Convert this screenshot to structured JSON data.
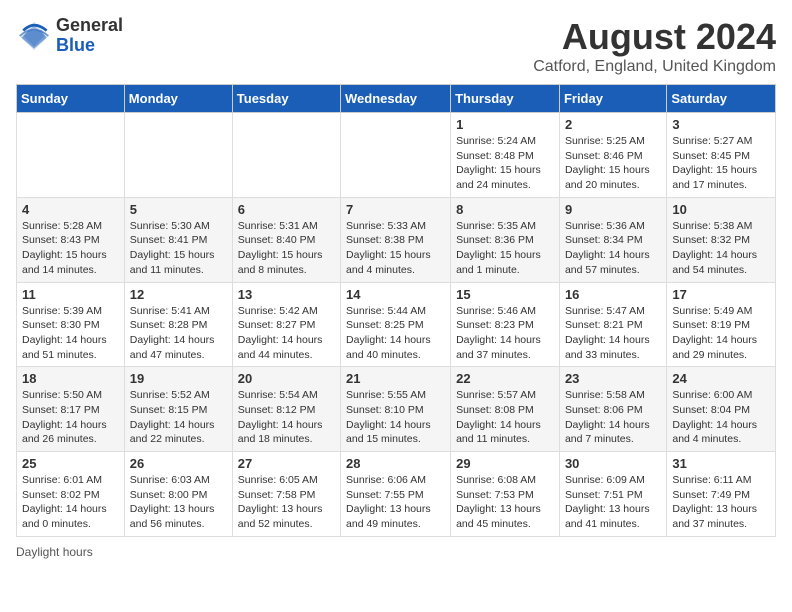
{
  "header": {
    "logo_general": "General",
    "logo_blue": "Blue",
    "month_title": "August 2024",
    "location": "Catford, England, United Kingdom"
  },
  "days_of_week": [
    "Sunday",
    "Monday",
    "Tuesday",
    "Wednesday",
    "Thursday",
    "Friday",
    "Saturday"
  ],
  "weeks": [
    [
      {
        "day": "",
        "info": ""
      },
      {
        "day": "",
        "info": ""
      },
      {
        "day": "",
        "info": ""
      },
      {
        "day": "",
        "info": ""
      },
      {
        "day": "1",
        "info": "Sunrise: 5:24 AM\nSunset: 8:48 PM\nDaylight: 15 hours\nand 24 minutes."
      },
      {
        "day": "2",
        "info": "Sunrise: 5:25 AM\nSunset: 8:46 PM\nDaylight: 15 hours\nand 20 minutes."
      },
      {
        "day": "3",
        "info": "Sunrise: 5:27 AM\nSunset: 8:45 PM\nDaylight: 15 hours\nand 17 minutes."
      }
    ],
    [
      {
        "day": "4",
        "info": "Sunrise: 5:28 AM\nSunset: 8:43 PM\nDaylight: 15 hours\nand 14 minutes."
      },
      {
        "day": "5",
        "info": "Sunrise: 5:30 AM\nSunset: 8:41 PM\nDaylight: 15 hours\nand 11 minutes."
      },
      {
        "day": "6",
        "info": "Sunrise: 5:31 AM\nSunset: 8:40 PM\nDaylight: 15 hours\nand 8 minutes."
      },
      {
        "day": "7",
        "info": "Sunrise: 5:33 AM\nSunset: 8:38 PM\nDaylight: 15 hours\nand 4 minutes."
      },
      {
        "day": "8",
        "info": "Sunrise: 5:35 AM\nSunset: 8:36 PM\nDaylight: 15 hours\nand 1 minute."
      },
      {
        "day": "9",
        "info": "Sunrise: 5:36 AM\nSunset: 8:34 PM\nDaylight: 14 hours\nand 57 minutes."
      },
      {
        "day": "10",
        "info": "Sunrise: 5:38 AM\nSunset: 8:32 PM\nDaylight: 14 hours\nand 54 minutes."
      }
    ],
    [
      {
        "day": "11",
        "info": "Sunrise: 5:39 AM\nSunset: 8:30 PM\nDaylight: 14 hours\nand 51 minutes."
      },
      {
        "day": "12",
        "info": "Sunrise: 5:41 AM\nSunset: 8:28 PM\nDaylight: 14 hours\nand 47 minutes."
      },
      {
        "day": "13",
        "info": "Sunrise: 5:42 AM\nSunset: 8:27 PM\nDaylight: 14 hours\nand 44 minutes."
      },
      {
        "day": "14",
        "info": "Sunrise: 5:44 AM\nSunset: 8:25 PM\nDaylight: 14 hours\nand 40 minutes."
      },
      {
        "day": "15",
        "info": "Sunrise: 5:46 AM\nSunset: 8:23 PM\nDaylight: 14 hours\nand 37 minutes."
      },
      {
        "day": "16",
        "info": "Sunrise: 5:47 AM\nSunset: 8:21 PM\nDaylight: 14 hours\nand 33 minutes."
      },
      {
        "day": "17",
        "info": "Sunrise: 5:49 AM\nSunset: 8:19 PM\nDaylight: 14 hours\nand 29 minutes."
      }
    ],
    [
      {
        "day": "18",
        "info": "Sunrise: 5:50 AM\nSunset: 8:17 PM\nDaylight: 14 hours\nand 26 minutes."
      },
      {
        "day": "19",
        "info": "Sunrise: 5:52 AM\nSunset: 8:15 PM\nDaylight: 14 hours\nand 22 minutes."
      },
      {
        "day": "20",
        "info": "Sunrise: 5:54 AM\nSunset: 8:12 PM\nDaylight: 14 hours\nand 18 minutes."
      },
      {
        "day": "21",
        "info": "Sunrise: 5:55 AM\nSunset: 8:10 PM\nDaylight: 14 hours\nand 15 minutes."
      },
      {
        "day": "22",
        "info": "Sunrise: 5:57 AM\nSunset: 8:08 PM\nDaylight: 14 hours\nand 11 minutes."
      },
      {
        "day": "23",
        "info": "Sunrise: 5:58 AM\nSunset: 8:06 PM\nDaylight: 14 hours\nand 7 minutes."
      },
      {
        "day": "24",
        "info": "Sunrise: 6:00 AM\nSunset: 8:04 PM\nDaylight: 14 hours\nand 4 minutes."
      }
    ],
    [
      {
        "day": "25",
        "info": "Sunrise: 6:01 AM\nSunset: 8:02 PM\nDaylight: 14 hours\nand 0 minutes."
      },
      {
        "day": "26",
        "info": "Sunrise: 6:03 AM\nSunset: 8:00 PM\nDaylight: 13 hours\nand 56 minutes."
      },
      {
        "day": "27",
        "info": "Sunrise: 6:05 AM\nSunset: 7:58 PM\nDaylight: 13 hours\nand 52 minutes."
      },
      {
        "day": "28",
        "info": "Sunrise: 6:06 AM\nSunset: 7:55 PM\nDaylight: 13 hours\nand 49 minutes."
      },
      {
        "day": "29",
        "info": "Sunrise: 6:08 AM\nSunset: 7:53 PM\nDaylight: 13 hours\nand 45 minutes."
      },
      {
        "day": "30",
        "info": "Sunrise: 6:09 AM\nSunset: 7:51 PM\nDaylight: 13 hours\nand 41 minutes."
      },
      {
        "day": "31",
        "info": "Sunrise: 6:11 AM\nSunset: 7:49 PM\nDaylight: 13 hours\nand 37 minutes."
      }
    ]
  ],
  "footer": {
    "note": "Daylight hours"
  }
}
